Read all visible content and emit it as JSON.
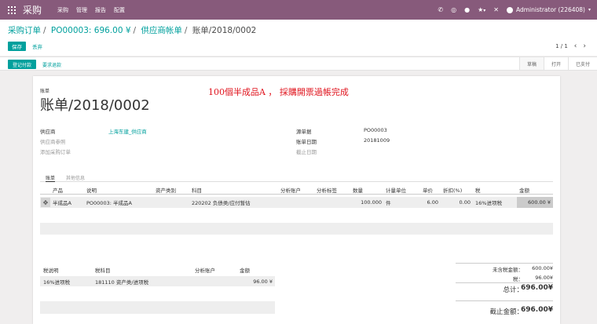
{
  "topbar": {
    "app_title": "采购",
    "menu": [
      "采购",
      "管理",
      "报告",
      "配置"
    ],
    "user": "Administrator (226408)"
  },
  "control": {
    "breadcrumb": [
      "采购订单",
      "PO00003: 696.00 ¥",
      "供应商帐单",
      "账单/2018/0002"
    ],
    "save_label": "保存",
    "discard_label": "丢弃",
    "pager": "1 / 1"
  },
  "statusbar": {
    "register_payment": "登记付款",
    "ask_refund": "要求退款",
    "states": [
      "草稿",
      "打开",
      "已支付"
    ],
    "active_state": 0
  },
  "sheet": {
    "type_label": "账单",
    "title": "账单/2018/0002",
    "annotation": "100個半成品A ， 採購開票過帳完成",
    "left_fields": {
      "vendor_label": "供应商",
      "vendor_value": "上海东建_供应商",
      "vendor_ref_label": "供应商参照",
      "add_purchase_label": "添加采购订单"
    },
    "right_fields": {
      "source_label": "源单据",
      "source_value": "PO00003",
      "bill_date_label": "账单日期",
      "bill_date_value": "20181009",
      "due_date_label": "截止日期"
    },
    "tabs": [
      "账单",
      "其他信息"
    ],
    "lines": {
      "headers": [
        "产品",
        "说明",
        "资产类别",
        "科目",
        "分析账户",
        "分析标签",
        "数量",
        "计量单位",
        "单价",
        "折扣(%)",
        "税",
        "金额"
      ],
      "rows": [
        {
          "product": "半成品A",
          "description": "PO00003: 半成品A",
          "asset": "",
          "account": "220202 负债类/应付暂估",
          "analytic": "",
          "tags": "",
          "qty": "100.000",
          "uom": "件",
          "price": "6.00",
          "discount": "0.00",
          "tax": "16%进项税",
          "amount": "600.00 ¥"
        }
      ]
    },
    "tax_table": {
      "headers": [
        "税说明",
        "税科目",
        "分析账户",
        "金额"
      ],
      "rows": [
        {
          "desc": "16%进项税",
          "account": "181110 资产类/进项税",
          "analytic": "",
          "amount": "96.00 ¥"
        }
      ]
    },
    "totals": {
      "untaxed_label": "未含税金额：",
      "untaxed_value": "600.00¥",
      "tax_label": "税：",
      "tax_value": "96.00¥",
      "total_label": "总计：",
      "total_value": "696.00¥",
      "due_label": "截止金额：",
      "due_value": "696.00¥"
    }
  },
  "colors": {
    "brand": "#875a7b",
    "accent": "#00a09d",
    "annotation": "#e0141e"
  },
  "icons": {
    "apps": "apps-grid-icon",
    "phone": "phone-icon",
    "globe": "globe-icon",
    "chat": "chat-icon",
    "activity": "activity-icon",
    "close": "close-icon",
    "handle": "drag-handle-icon"
  }
}
